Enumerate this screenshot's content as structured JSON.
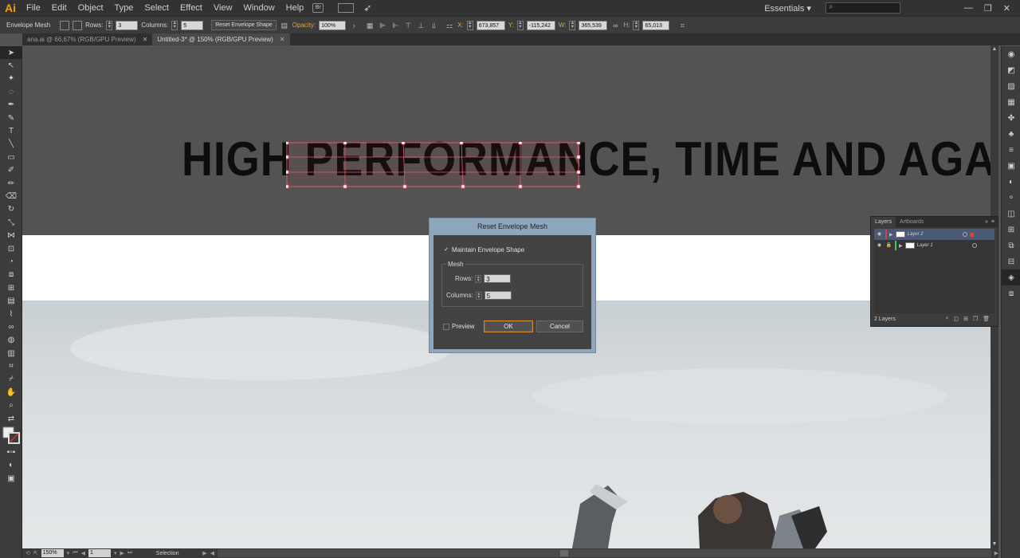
{
  "app": {
    "logo": "Ai"
  },
  "menu": [
    "File",
    "Edit",
    "Object",
    "Type",
    "Select",
    "Effect",
    "View",
    "Window",
    "Help"
  ],
  "menubar_extra": {
    "bridge": "Br",
    "workspace": "Essentials ▾"
  },
  "control": {
    "mode": "Envelope Mesh",
    "rows_label": "Rows:",
    "rows": "3",
    "columns_label": "Columns:",
    "columns": "5",
    "reset_button": "Reset Envelope Shape",
    "opacity_label": "Opacity:",
    "opacity": "100%",
    "x_label": "X:",
    "x": "673,857 px",
    "y_label": "Y:",
    "y": "-115,242 px",
    "w_label": "W:",
    "w": "365,539 px",
    "h_label": "H:",
    "h": "65,013 px"
  },
  "tabs": [
    {
      "label": "ana.ai @ 66,67% (RGB/GPU Preview)"
    },
    {
      "label": "Untitled-3* @ 150% (RGB/GPU Preview)"
    }
  ],
  "canvas": {
    "headline": "HIGH PERFORMANCE, TIME AND AGAIN"
  },
  "dialog": {
    "title": "Reset Envelope Mesh",
    "maintain_label": "Maintain Envelope Shape",
    "maintain_checked": "✓",
    "mesh_group": "Mesh",
    "rows_label": "Rows:",
    "rows": "3",
    "columns_label": "Columns:",
    "columns": "5",
    "preview_label": "Preview",
    "ok": "OK",
    "cancel": "Cancel"
  },
  "layers_panel": {
    "tabs": [
      "Layers",
      "Artboards"
    ],
    "layers": [
      {
        "name": "Layer 2",
        "color": "#e0394a"
      },
      {
        "name": "Layer 1",
        "color": "#3cc85a"
      }
    ],
    "count": "2 Layers"
  },
  "status": {
    "zoom": "150%",
    "page": "1",
    "tool": "Selection"
  }
}
